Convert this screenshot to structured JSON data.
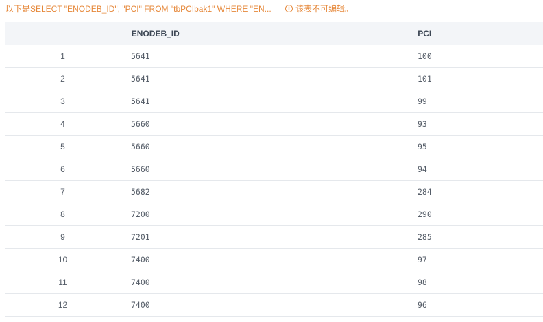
{
  "notice": {
    "query": "以下是SELECT \"ENODEB_ID\", \"PCI\" FROM \"tbPCIbak1\" WHERE \"EN...",
    "readonly_text": "该表不可编辑。",
    "accent_color": "#e6883a",
    "icon": "info-icon"
  },
  "table": {
    "columns": [
      "",
      "ENODEB_ID",
      "PCI"
    ],
    "rows": [
      {
        "idx": "1",
        "enodeb_id": "5641",
        "pci": "100"
      },
      {
        "idx": "2",
        "enodeb_id": "5641",
        "pci": "101"
      },
      {
        "idx": "3",
        "enodeb_id": "5641",
        "pci": "99"
      },
      {
        "idx": "4",
        "enodeb_id": "5660",
        "pci": "93"
      },
      {
        "idx": "5",
        "enodeb_id": "5660",
        "pci": "95"
      },
      {
        "idx": "6",
        "enodeb_id": "5660",
        "pci": "94"
      },
      {
        "idx": "7",
        "enodeb_id": "5682",
        "pci": "284"
      },
      {
        "idx": "8",
        "enodeb_id": "7200",
        "pci": "290"
      },
      {
        "idx": "9",
        "enodeb_id": "7201",
        "pci": "285"
      },
      {
        "idx": "10",
        "enodeb_id": "7400",
        "pci": "97"
      },
      {
        "idx": "11",
        "enodeb_id": "7400",
        "pci": "98"
      },
      {
        "idx": "12",
        "enodeb_id": "7400",
        "pci": "96"
      }
    ]
  }
}
